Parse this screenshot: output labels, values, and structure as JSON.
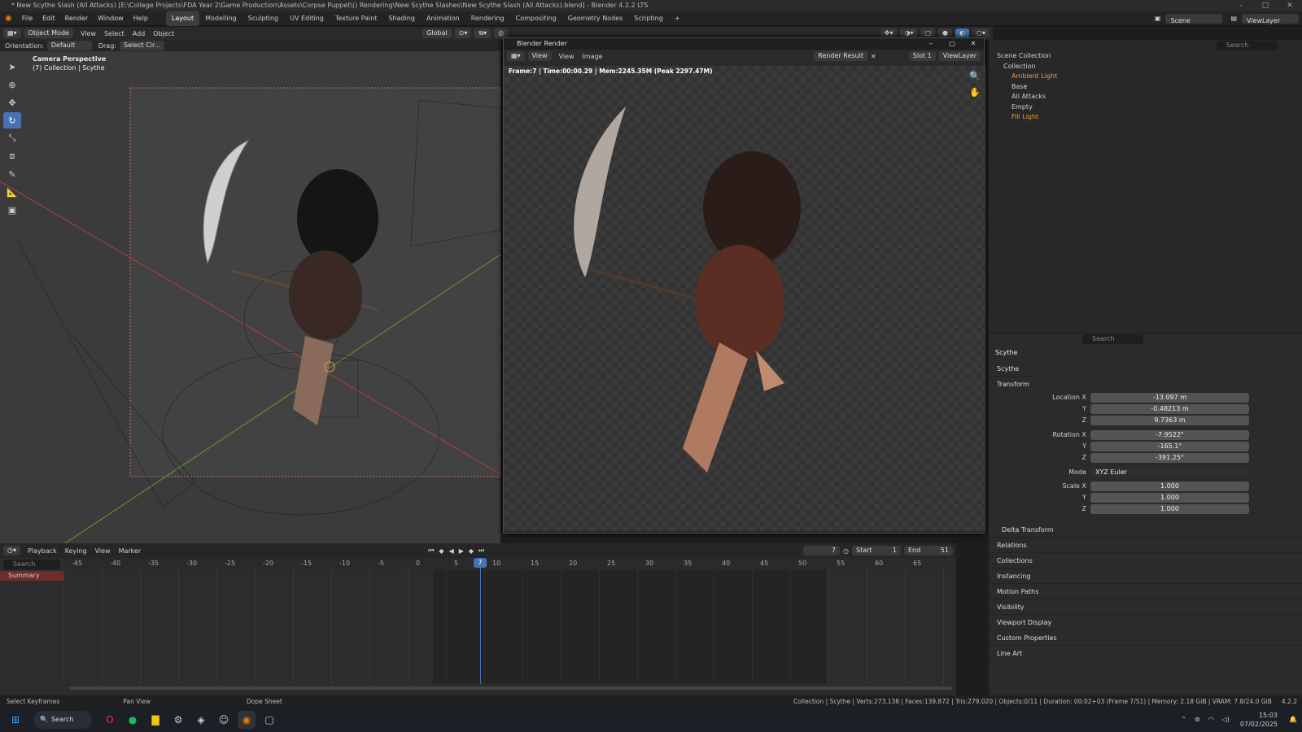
{
  "window": {
    "title": "* New Scythe Slash (All Attacks) [E:\\College Projects\\FDA Year 2\\Game Production\\Assets\\Corpse Puppet\\() Rendering\\New Scythe Slashes\\New Scythe Slash (All Attacks).blend] - Blender 4.2.2 LTS"
  },
  "menu": [
    "File",
    "Edit",
    "Render",
    "Window",
    "Help"
  ],
  "workspaces": [
    "Layout",
    "Modelling",
    "Sculpting",
    "UV Editing",
    "Texture Paint",
    "Shading",
    "Animation",
    "Rendering",
    "Compositing",
    "Geometry Nodes",
    "Scripting",
    "+"
  ],
  "scene": {
    "label": "Scene",
    "view_layer": "ViewLayer"
  },
  "viewport_header": {
    "mode": "Object Mode",
    "view": "View",
    "select": "Select",
    "add": "Add",
    "object": "Object",
    "orient": "Global"
  },
  "tool_header": {
    "orientation_label": "Orientation:",
    "orientation": "Default",
    "drag_label": "Drag:",
    "drag": "Select Cir..."
  },
  "viewport": {
    "title": "Camera Perspective",
    "subtitle": "(7) Collection | Scythe"
  },
  "render_window": {
    "title": "Blender Render",
    "menu": [
      "View",
      "View",
      "Image"
    ],
    "result": "Render Result",
    "slot": "Slot 1",
    "layer": "ViewLayer",
    "info": "Frame:7 | Time:00:00.29 | Mem:2245.35M (Peak 2297.47M)"
  },
  "outliner": {
    "search_placeholder": "Search",
    "items": [
      {
        "label": "Scene Collection",
        "depth": 0
      },
      {
        "label": "Collection",
        "depth": 1
      },
      {
        "label": "Ambient Light",
        "depth": 2
      },
      {
        "label": "Base",
        "depth": 2
      },
      {
        "label": "All Attacks",
        "depth": 2
      },
      {
        "label": "Empty",
        "depth": 2
      },
      {
        "label": "Fill Light",
        "depth": 2
      }
    ]
  },
  "properties": {
    "search_placeholder": "Search",
    "object_name": "Scythe",
    "data_name": "Scythe",
    "transform": "Transform",
    "location_label": "Location X",
    "location": [
      "-13.097 m",
      "-0.48213 m",
      "9.7363 m"
    ],
    "rotation_label": "Rotation X",
    "rotation": [
      "-7.9522°",
      "-165.1°",
      "-391.25°"
    ],
    "mode_label": "Mode",
    "mode": "XYZ Euler",
    "scale_label": "Scale X",
    "scale": [
      "1.000",
      "1.000",
      "1.000"
    ],
    "axes": [
      "Y",
      "Z"
    ],
    "delta": "Delta Transform",
    "panels": [
      "Relations",
      "Collections",
      "Instancing",
      "Motion Paths",
      "Visibility",
      "Viewport Display",
      "Custom Properties",
      "Line Art"
    ]
  },
  "timeline": {
    "menu": [
      "Playback",
      "Keying",
      "View",
      "Marker"
    ],
    "current_frame": "7",
    "start_label": "Start",
    "start": "1",
    "end_label": "End",
    "end": "51",
    "search_placeholder": "Search",
    "summary": "Summary",
    "ticks": [
      "-45",
      "-40",
      "-35",
      "-30",
      "-25",
      "-20",
      "-15",
      "-10",
      "-5",
      "0",
      "5",
      "7",
      "10",
      "15",
      "20",
      "25",
      "30",
      "35",
      "40",
      "45",
      "50",
      "55",
      "60",
      "65"
    ]
  },
  "statusbar": {
    "left": [
      "Select Keyframes",
      "Pan View",
      "Dope Sheet"
    ],
    "right": "Collection | Scythe | Verts:273,138 | Faces:139,872 | Tris:279,020 | Objects:0/11 | Duration: 00:02+03 (Frame 7/51) | Memory: 2.18 GiB | VRAM: 7.8/24.0 GiB",
    "version": "4.2.2"
  },
  "taskbar": {
    "search": "Search",
    "time": "15:03",
    "date": "07/02/2025"
  },
  "colors": {
    "accent": "#4772b3",
    "active_blue": "#5680c2",
    "playhead": "#4772b3"
  }
}
